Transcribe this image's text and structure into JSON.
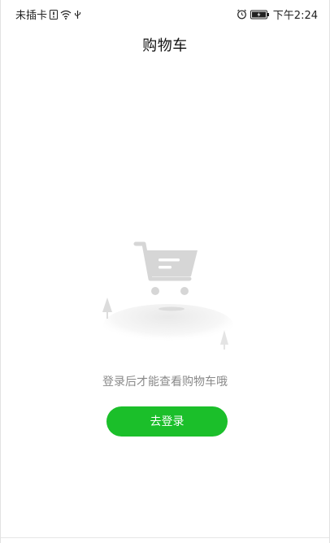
{
  "status_bar": {
    "carrier": "未插卡",
    "time": "下午2:24",
    "icons": [
      "sim-icon",
      "wifi-icon",
      "usb-icon",
      "alarm-icon",
      "battery-icon"
    ]
  },
  "page": {
    "title": "购物车"
  },
  "empty_state": {
    "message": "登录后才能查看购物车哦",
    "button_label": "去登录",
    "illustration": "empty-cart-illustration"
  },
  "colors": {
    "accent": "#1bbf2a",
    "text_primary": "#111111",
    "text_secondary": "#8a8a8a",
    "cart_gray": "#d9d9d9"
  }
}
